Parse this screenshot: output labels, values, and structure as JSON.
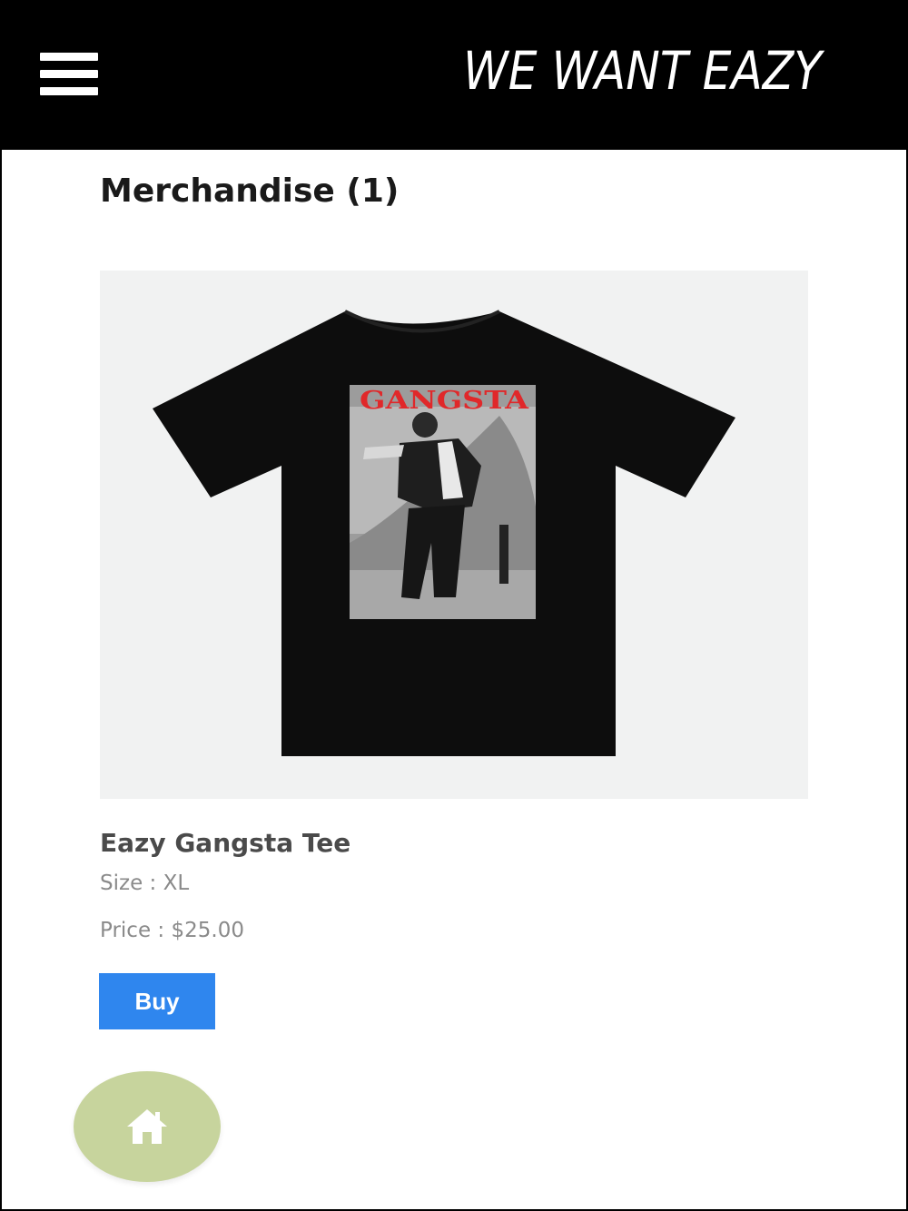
{
  "header": {
    "brand": "WE WANT EAZY",
    "menu_icon": "hamburger-menu-icon",
    "background": "#000000"
  },
  "page": {
    "title": "Merchandise (1)"
  },
  "product": {
    "image_text": "GANGSTA",
    "name": "Eazy Gangsta Tee",
    "size": "Size : XL",
    "price": "Price : $25.00",
    "buy_label": "Buy",
    "buy_color": "#2f86ee"
  },
  "fab": {
    "icon": "home-icon",
    "color": "#c7d49d"
  }
}
